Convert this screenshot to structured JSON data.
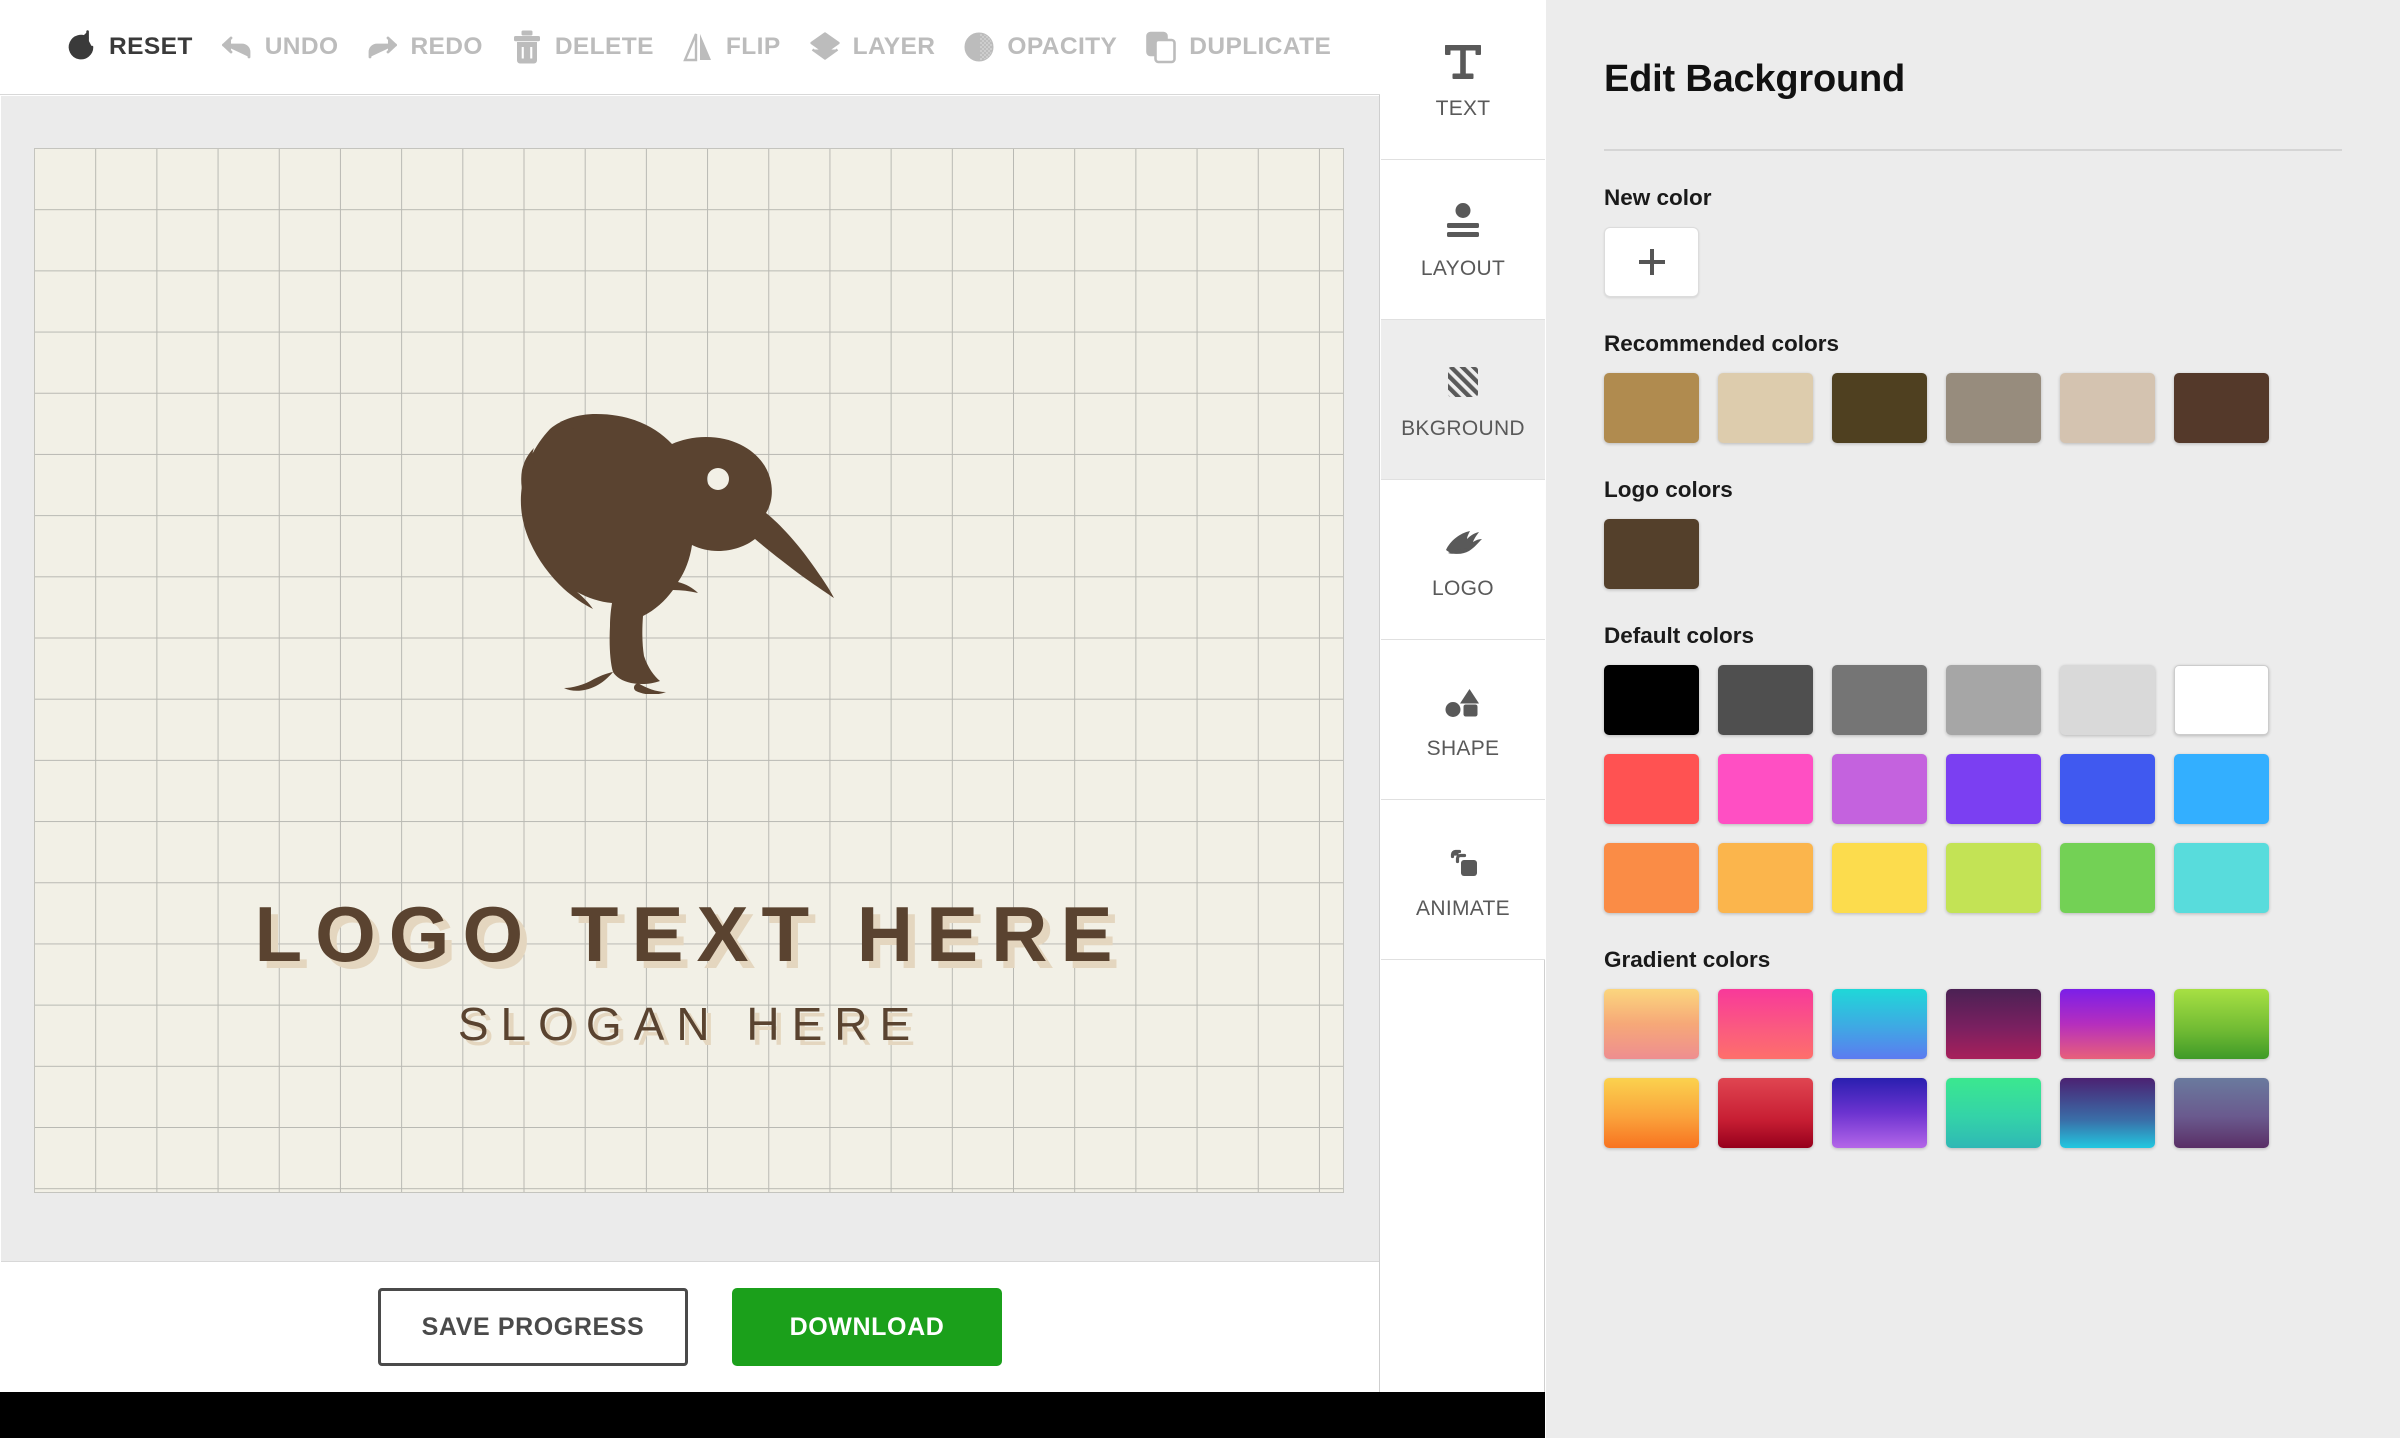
{
  "toolbar": {
    "items": [
      {
        "label": "RESET",
        "icon": "reset-icon",
        "state": "active"
      },
      {
        "label": "UNDO",
        "icon": "undo-icon",
        "state": "dim"
      },
      {
        "label": "REDO",
        "icon": "redo-icon",
        "state": "dim"
      },
      {
        "label": "DELETE",
        "icon": "trash-icon",
        "state": "dim"
      },
      {
        "label": "FLIP",
        "icon": "flip-icon",
        "state": "dim"
      },
      {
        "label": "LAYER",
        "icon": "layers-icon",
        "state": "dim"
      },
      {
        "label": "OPACITY",
        "icon": "opacity-icon",
        "state": "dim"
      },
      {
        "label": "DUPLICATE",
        "icon": "duplicate-icon",
        "state": "dim"
      }
    ]
  },
  "canvas": {
    "logo_text": "LOGO TEXT HERE",
    "slogan_text": "SLOGAN HERE",
    "logo_icon": "kiwi-bird-icon",
    "background_color": "#F2F0E6",
    "grid_line_color": "#B9B9B3",
    "art_color": "#5A4330",
    "text_shadow_color": "#E4D6BF"
  },
  "actions": {
    "save_label": "SAVE PROGRESS",
    "download_label": "DOWNLOAD",
    "download_color": "#1BA01B"
  },
  "tabs": [
    {
      "label": "TEXT",
      "icon": "text-t-icon",
      "active": false
    },
    {
      "label": "LAYOUT",
      "icon": "layout-icon",
      "active": false
    },
    {
      "label": "BKGROUND",
      "icon": "hatch-pattern-icon",
      "active": true
    },
    {
      "label": "LOGO",
      "icon": "leaf-logo-icon",
      "active": false
    },
    {
      "label": "SHAPE",
      "icon": "shapes-icon",
      "active": false
    },
    {
      "label": "ANIMATE",
      "icon": "animate-stack-icon",
      "active": false
    }
  ],
  "panel": {
    "title": "Edit Background",
    "new_color": {
      "label": "New color",
      "button_icon": "plus-icon"
    },
    "recommended": {
      "label": "Recommended colors",
      "colors": [
        "#B08B4F",
        "#DDCCAD",
        "#4F4020",
        "#978C7D",
        "#D4C3B0",
        "#54392A"
      ]
    },
    "logo_colors": {
      "label": "Logo colors",
      "colors": [
        "#54402B"
      ]
    },
    "default_colors": {
      "label": "Default colors",
      "rows": [
        [
          "#000000",
          "#4F4F4F",
          "#757575",
          "#A6A6A6",
          "#D9D9D9",
          "#FFFFFF"
        ],
        [
          "#FF5252",
          "#FF4FC3",
          "#C462DE",
          "#7B3FF2",
          "#4059F0",
          "#33AFFF"
        ],
        [
          "#FA8C46",
          "#FBB54C",
          "#FCDC4D",
          "#C3E355",
          "#73D155",
          "#58DCDC"
        ]
      ]
    },
    "gradient_colors": {
      "label": "Gradient colors",
      "rows": [
        [
          "linear-gradient(180deg,#FBD67E 0%,#F6A878 50%,#EE8E90 100%)",
          "linear-gradient(180deg,#F8399A 0%,#FB5C7E 60%,#FE6F6B 100%)",
          "linear-gradient(180deg,#1FD8D8 0%,#3FA8E4 55%,#5C7BF0 100%)",
          "linear-gradient(180deg,#4B2154 0%,#7A2060 55%,#A8205B 100%)",
          "linear-gradient(180deg,#7B1FE8 0%,#B52EBE 50%,#E8607A 100%)",
          "linear-gradient(180deg,#A7E043 0%,#6FBA33 60%,#3F9A28 100%)"
        ],
        [
          "linear-gradient(180deg,#FBD24E 0%,#FAA33C 55%,#F87320 100%)",
          "linear-gradient(180deg,#E04551 0%,#C71E33 60%,#96001C 100%)",
          "linear-gradient(180deg,#2A1FB0 0%,#6C33D0 50%,#B466E8 100%)",
          "linear-gradient(180deg,#3BE88F 0%,#34D3A8 55%,#2FB8B5 100%)",
          "linear-gradient(180deg,#4B2172 0%,#3A6EA8 60%,#22C8E0 100%)",
          "linear-gradient(180deg,#6A7A9E 0%,#6A5A8E 55%,#5A2F66 100%)"
        ]
      ]
    }
  }
}
